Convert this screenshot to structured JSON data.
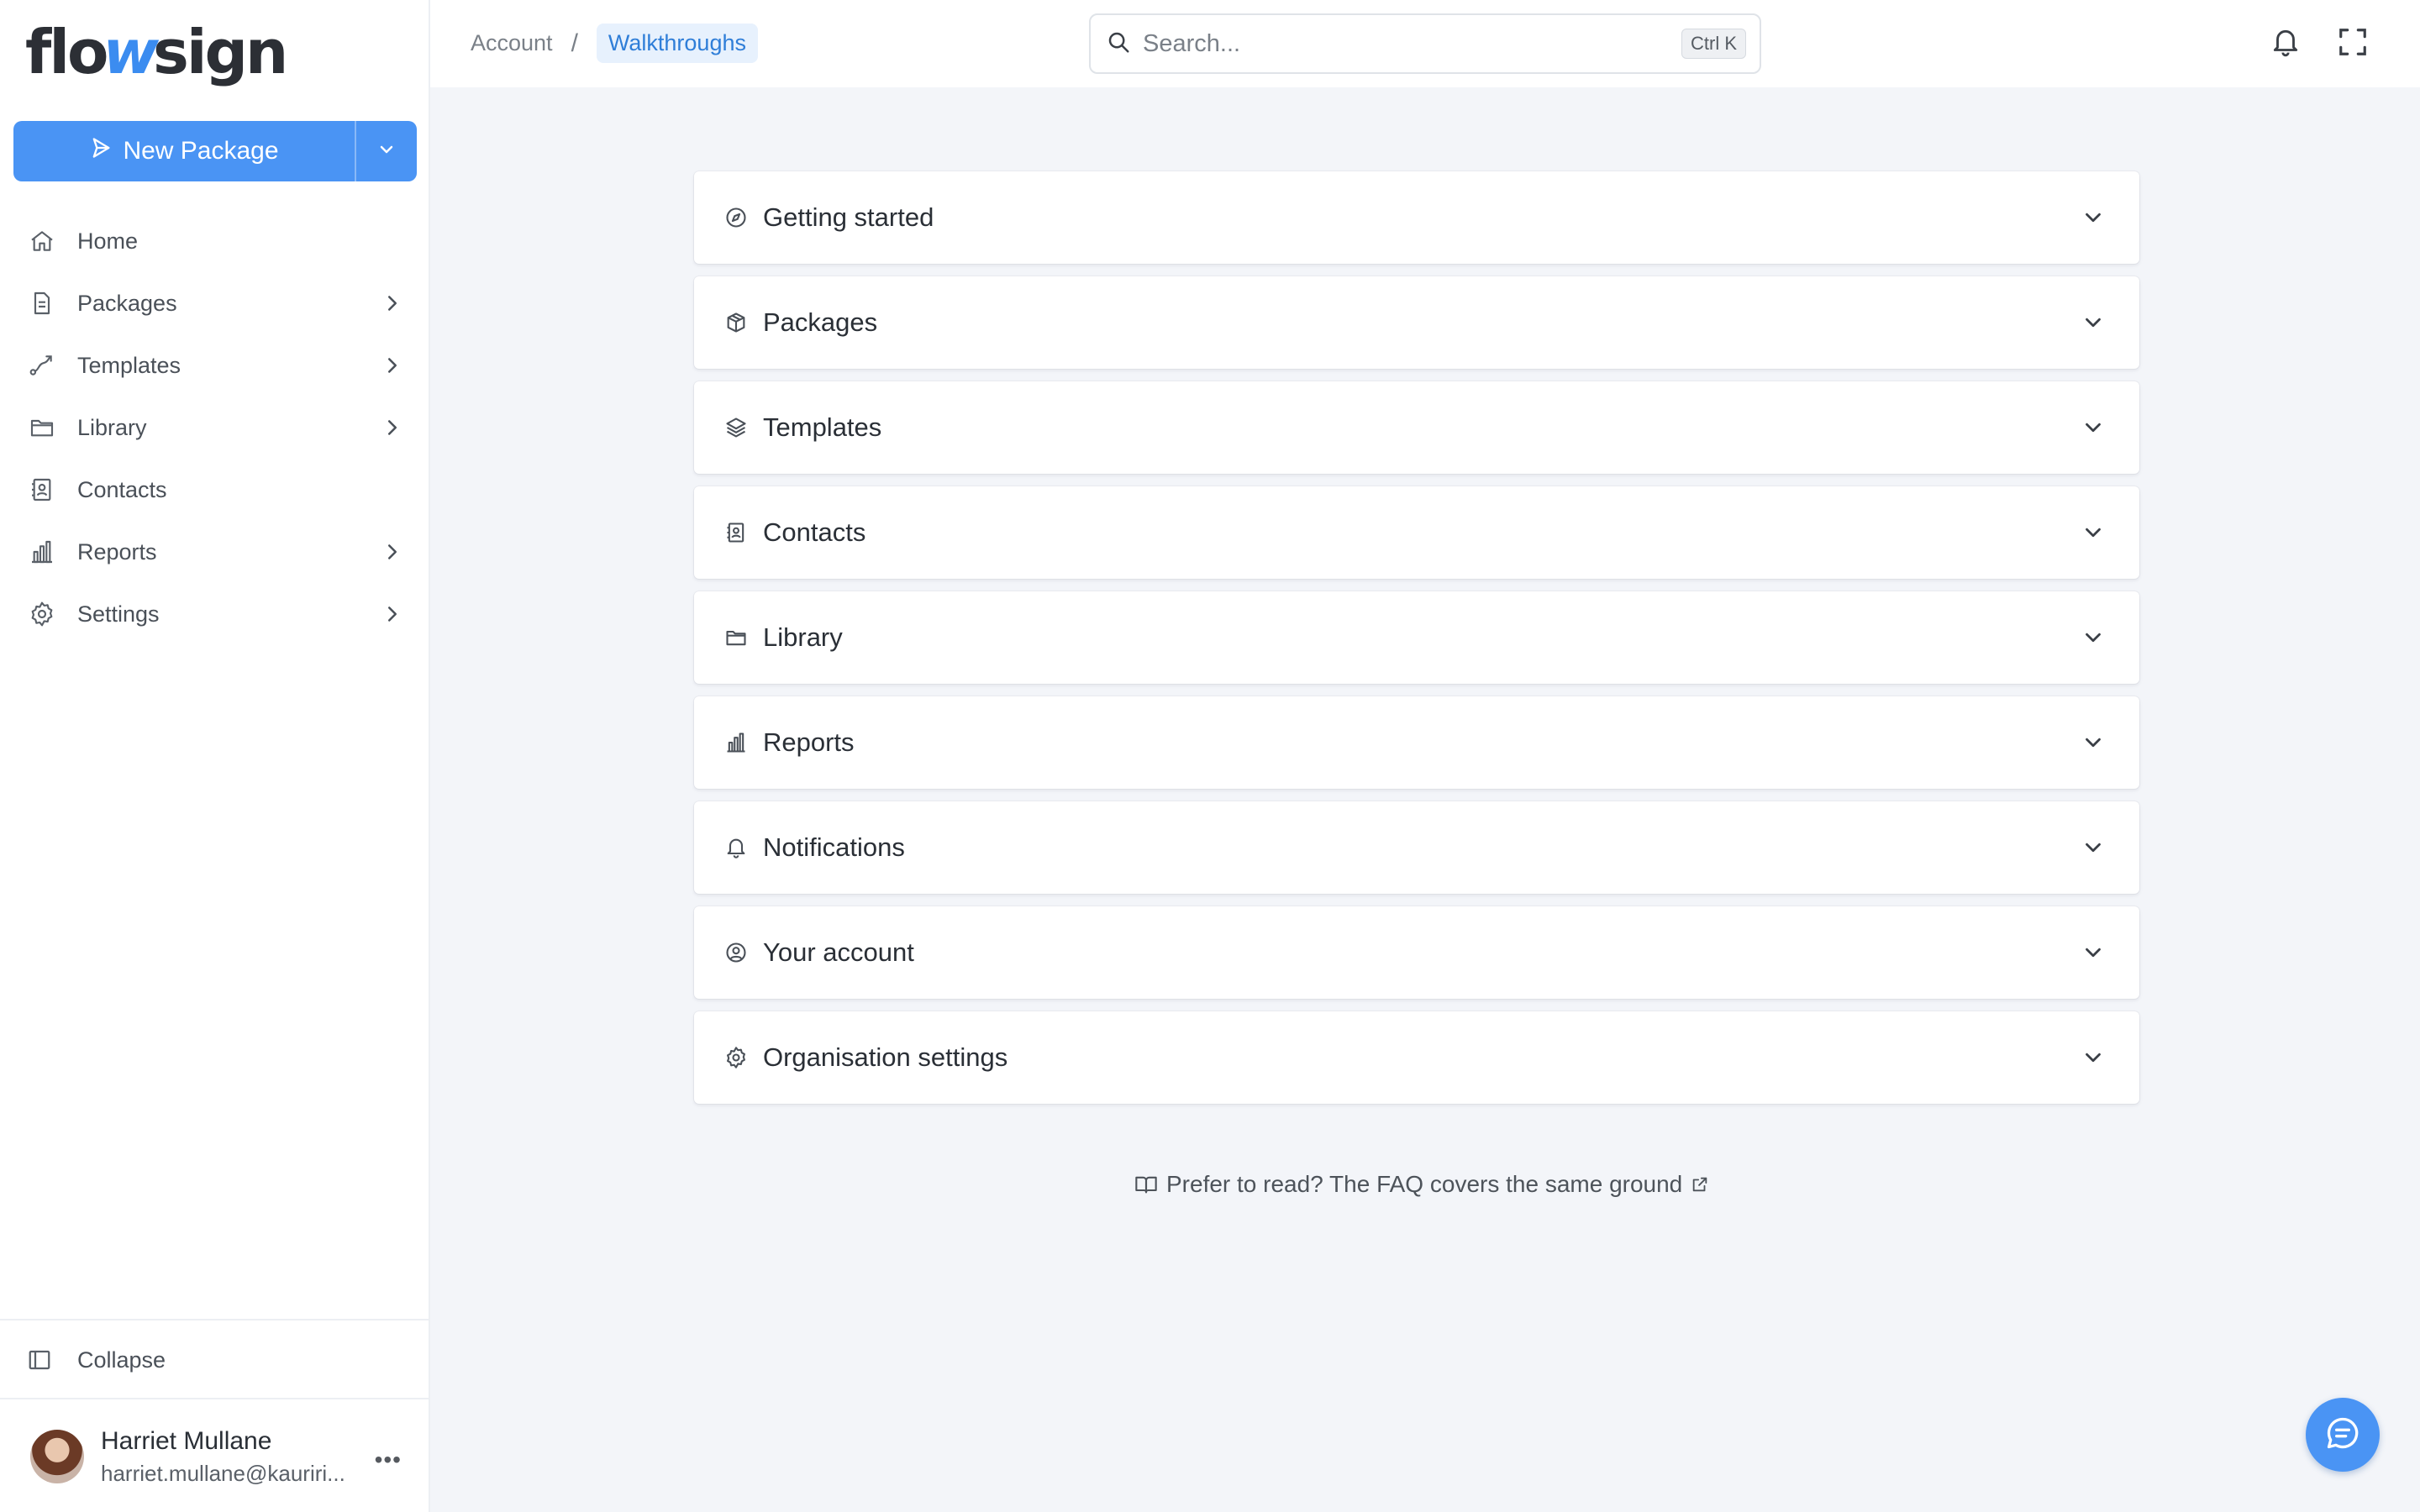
{
  "app": {
    "logo_pre": "flo",
    "logo_wave": "w",
    "logo_post": "sign"
  },
  "sidebar": {
    "new_package_label": "New Package",
    "items": [
      {
        "label": "Home",
        "icon": "home-icon",
        "has_chevron": false
      },
      {
        "label": "Packages",
        "icon": "document-icon",
        "has_chevron": true
      },
      {
        "label": "Templates",
        "icon": "route-icon",
        "has_chevron": true
      },
      {
        "label": "Library",
        "icon": "folder-icon",
        "has_chevron": true
      },
      {
        "label": "Contacts",
        "icon": "contact-book-icon",
        "has_chevron": false
      },
      {
        "label": "Reports",
        "icon": "bar-chart-icon",
        "has_chevron": true
      },
      {
        "label": "Settings",
        "icon": "gear-icon",
        "has_chevron": true
      }
    ],
    "collapse_label": "Collapse",
    "user": {
      "name": "Harriet Mullane",
      "email": "harriet.mullane@kauriri..."
    }
  },
  "header": {
    "breadcrumb": {
      "parent": "Account",
      "separator": "/",
      "current": "Walkthroughs"
    },
    "search": {
      "placeholder": "Search...",
      "shortcut": "Ctrl K"
    }
  },
  "main": {
    "sections": [
      {
        "title": "Getting started",
        "icon": "compass-icon"
      },
      {
        "title": "Packages",
        "icon": "package-icon"
      },
      {
        "title": "Templates",
        "icon": "layers-icon"
      },
      {
        "title": "Contacts",
        "icon": "contact-book-icon"
      },
      {
        "title": "Library",
        "icon": "folder-icon"
      },
      {
        "title": "Reports",
        "icon": "bar-chart-icon"
      },
      {
        "title": "Notifications",
        "icon": "bell-icon"
      },
      {
        "title": "Your account",
        "icon": "user-circle-icon"
      },
      {
        "title": "Organisation settings",
        "icon": "gear-icon"
      }
    ],
    "faq_text": "Prefer to read? The FAQ covers the same ground"
  },
  "colors": {
    "accent": "#4a94f4",
    "link": "#2f7ed8",
    "background": "#f3f5f9"
  }
}
